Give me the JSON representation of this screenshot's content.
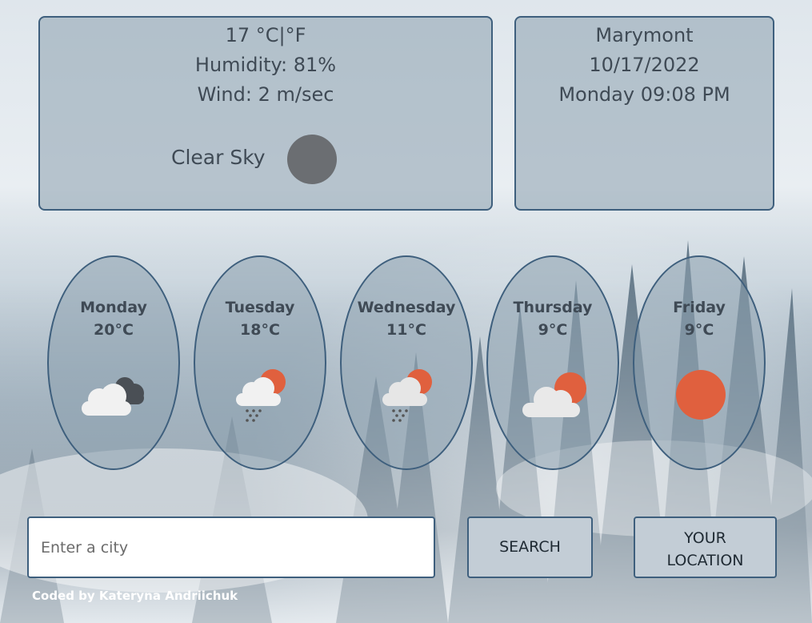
{
  "current": {
    "temperature": "17",
    "unit_c": "°C",
    "separator": "|",
    "unit_f": "°F",
    "humidity": "Humidity: 81%",
    "wind": "Wind: 2 m/sec",
    "description": "Clear Sky",
    "icon": "moon-night-icon"
  },
  "location": {
    "city": "Marymont",
    "date": "10/17/2022",
    "day_time": "Monday 09:08 PM"
  },
  "forecast": [
    {
      "day": "Monday",
      "temp": "20°C",
      "icon": "dark-clouds-icon"
    },
    {
      "day": "Tuesday",
      "temp": "18°C",
      "icon": "rain-sun-cloud-icon"
    },
    {
      "day": "Wednesday",
      "temp": "11°C",
      "icon": "rain-sun-cloud-icon"
    },
    {
      "day": "Thursday",
      "temp": "9°C",
      "icon": "cloud-sun-icon"
    },
    {
      "day": "Friday",
      "temp": "9°C",
      "icon": "sun-icon"
    }
  ],
  "search": {
    "placeholder": "Enter a city",
    "search_label": "SEARCH",
    "location_label_line1": "YOUR",
    "location_label_line2": "LOCATION"
  },
  "footer": "Coded by Kateryna Andriichuk",
  "colors": {
    "border": "#3e5f7d",
    "sun": "#e0603e",
    "moon": "#6b6e72"
  }
}
